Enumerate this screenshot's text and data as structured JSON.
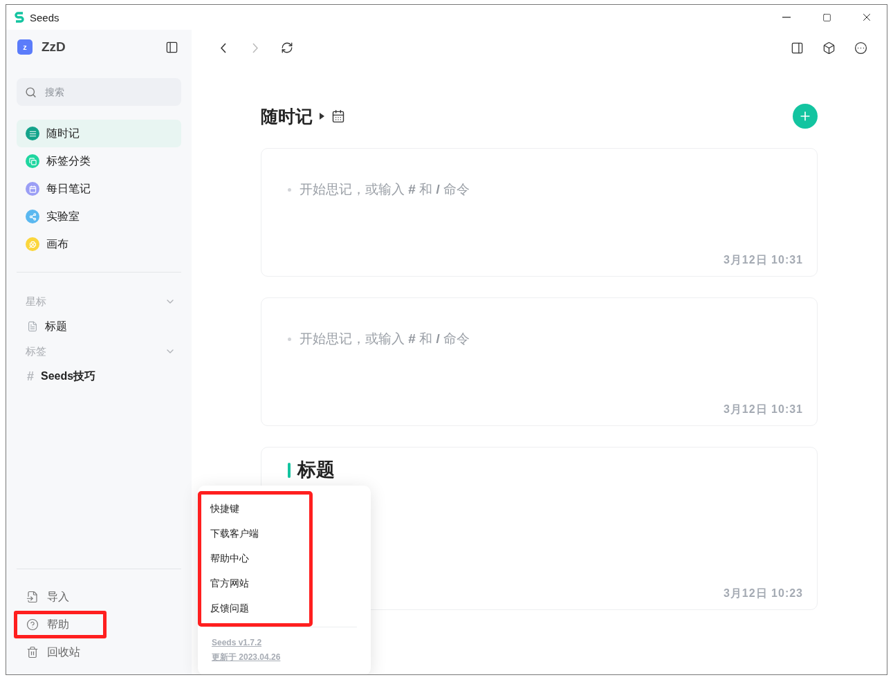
{
  "window": {
    "title": "Seeds"
  },
  "sidebar": {
    "workspace": {
      "initial": "z",
      "name": "ZzD"
    },
    "search": {
      "placeholder": "搜索"
    },
    "nav": [
      {
        "label": "随时记",
        "selected": true,
        "color": "#13a38a"
      },
      {
        "label": "标签分类",
        "selected": false,
        "color": "#1fd6a0"
      },
      {
        "label": "每日笔记",
        "selected": false,
        "color": "#9b9ef5"
      },
      {
        "label": "实验室",
        "selected": false,
        "color": "#5ab8f0"
      },
      {
        "label": "画布",
        "selected": false,
        "color": "#fbd63c"
      }
    ],
    "sections": [
      {
        "title": "星标",
        "expanded": true,
        "items": [
          {
            "kind": "note",
            "label": "标题"
          }
        ]
      },
      {
        "title": "标签",
        "expanded": true,
        "items": [
          {
            "kind": "tag",
            "marker": "#",
            "label": "Seeds技巧"
          }
        ]
      }
    ],
    "footer": [
      {
        "kind": "import",
        "label": "导入",
        "highlighted": false
      },
      {
        "kind": "help",
        "label": "帮助",
        "highlighted": true
      },
      {
        "kind": "trash",
        "label": "回收站",
        "highlighted": false
      }
    ]
  },
  "toolbar": {
    "back_disabled": false,
    "forward_disabled": true
  },
  "page": {
    "title": "随时记",
    "notes": [
      {
        "kind": "empty",
        "prompt": "开始思记，或输入 **#** 和 **/** 命令",
        "time": "3月12日 10:31"
      },
      {
        "kind": "empty",
        "prompt": "开始思记，或输入 **#** 和 **/** 命令",
        "time": "3月12日 10:31"
      },
      {
        "kind": "heading",
        "heading": "标题",
        "time": "3月12日 10:23"
      }
    ]
  },
  "help_menu": {
    "highlighted": true,
    "items": [
      "快捷键",
      "下载客户端",
      "帮助中心",
      "官方网站",
      "反馈问题"
    ],
    "version": "Seeds v1.7.2",
    "updated": "更新于 2023.04.26"
  }
}
